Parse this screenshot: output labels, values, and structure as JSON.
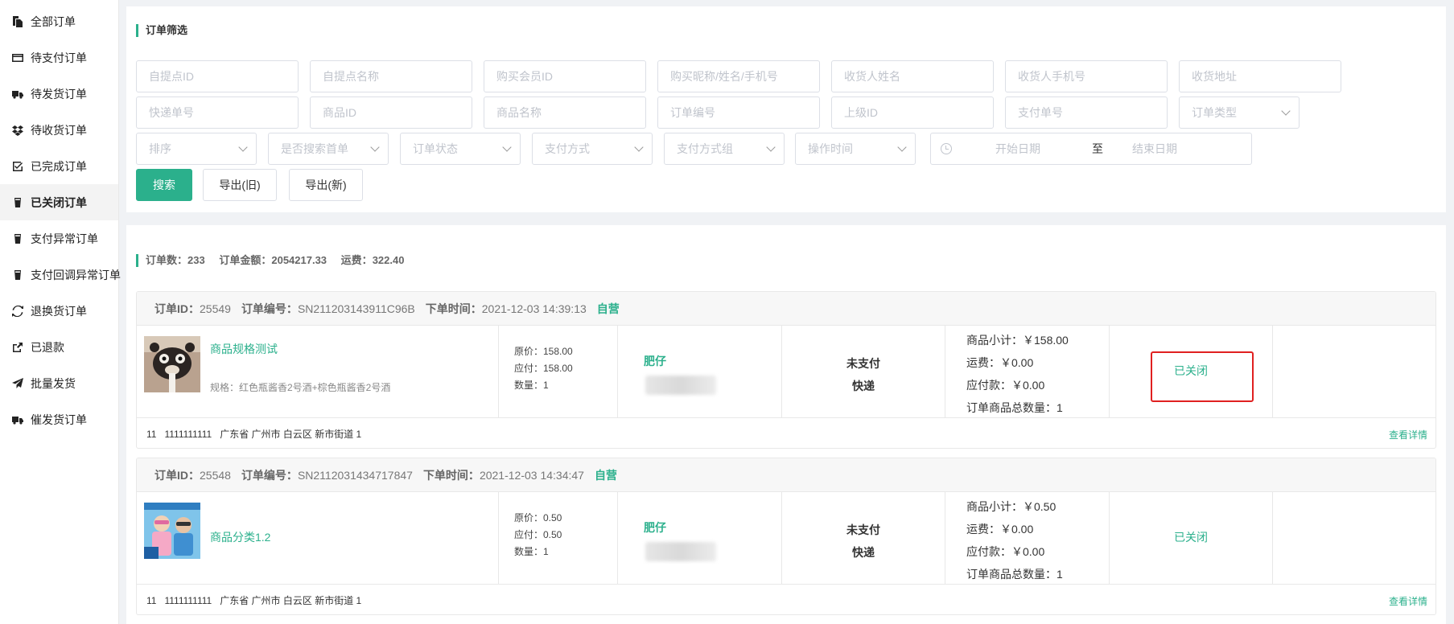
{
  "sidebar": {
    "items": [
      {
        "label": "全部订单",
        "icon": "copy-icon"
      },
      {
        "label": "待支付订单",
        "icon": "credit-card-icon"
      },
      {
        "label": "待发货订单",
        "icon": "truck-icon"
      },
      {
        "label": "待收货订单",
        "icon": "dropbox-icon"
      },
      {
        "label": "已完成订单",
        "icon": "check-square-icon"
      },
      {
        "label": "已关闭订单",
        "icon": "cup-icon",
        "active": true
      },
      {
        "label": "支付异常订单",
        "icon": "cup-icon"
      },
      {
        "label": "支付回调异常订单",
        "icon": "cup-icon"
      },
      {
        "label": "退换货订单",
        "icon": "refresh-icon"
      },
      {
        "label": "已退款",
        "icon": "share-square-icon"
      },
      {
        "label": "批量发货",
        "icon": "paper-plane-icon"
      },
      {
        "label": "催发货订单",
        "icon": "truck-icon"
      }
    ]
  },
  "filter": {
    "title": "订单筛选",
    "row1": [
      "自提点ID",
      "自提点名称",
      "购买会员ID",
      "购买昵称/姓名/手机号",
      "收货人姓名",
      "收货人手机号",
      "收货地址"
    ],
    "row2": [
      "快递单号",
      "商品ID",
      "商品名称",
      "订单编号",
      "上级ID",
      "支付单号"
    ],
    "order_type": "订单类型",
    "selects": [
      "排序",
      "是否搜索首单",
      "订单状态",
      "支付方式",
      "支付方式组",
      "操作时间"
    ],
    "date_start": "开始日期",
    "date_sep": "至",
    "date_end": "结束日期",
    "search_btn": "搜索",
    "export_old_btn": "导出(旧)",
    "export_new_btn": "导出(新)"
  },
  "summary": {
    "count_label": "订单数：",
    "count": "233",
    "amount_label": "订单金额：",
    "amount": "2054217.33",
    "freight_label": "运费：",
    "freight": "322.40"
  },
  "labels": {
    "order_id": "订单ID：",
    "order_no": "订单编号：",
    "order_time": "下单时间：",
    "detail": "查看详情"
  },
  "orders": [
    {
      "id": "25549",
      "no": "SN211203143911C96B",
      "time": "2021-12-03 14:39:13",
      "tag": "自营",
      "product_name": "商品规格测试",
      "product_spec": "规格：红色瓶酱香2号酒+棕色瓶酱香2号酒",
      "price_original": "原价：158.00",
      "price_payable": "应付：158.00",
      "quantity": "数量：1",
      "buyer": "肥仔",
      "pay_status": "未支付",
      "delivery": "快递",
      "subtotal": "商品小计：￥158.00",
      "freight": "运费：￥0.00",
      "payable": "应付款：￥0.00",
      "total_qty": "订单商品总数量：1",
      "status": "已关闭",
      "addr_name": "11",
      "addr_phone": "1111111111",
      "addr_region": "广东省 广州市 白云区 新市街道 1"
    },
    {
      "id": "25548",
      "no": "SN2112031434717847",
      "time": "2021-12-03 14:34:47",
      "tag": "自营",
      "product_name": "商品分类1.2",
      "price_original": "原价：0.50",
      "price_payable": "应付：0.50",
      "quantity": "数量：1",
      "buyer": "肥仔",
      "pay_status": "未支付",
      "delivery": "快递",
      "subtotal": "商品小计：￥0.50",
      "freight": "运费：￥0.00",
      "payable": "应付款：￥0.00",
      "total_qty": "订单商品总数量：1",
      "status": "已关闭",
      "addr_name": "11",
      "addr_phone": "1111111111",
      "addr_region": "广东省 广州市 白云区 新市街道 1"
    }
  ],
  "colors": {
    "accent": "#2bb08c",
    "highlight": "#e02020"
  }
}
